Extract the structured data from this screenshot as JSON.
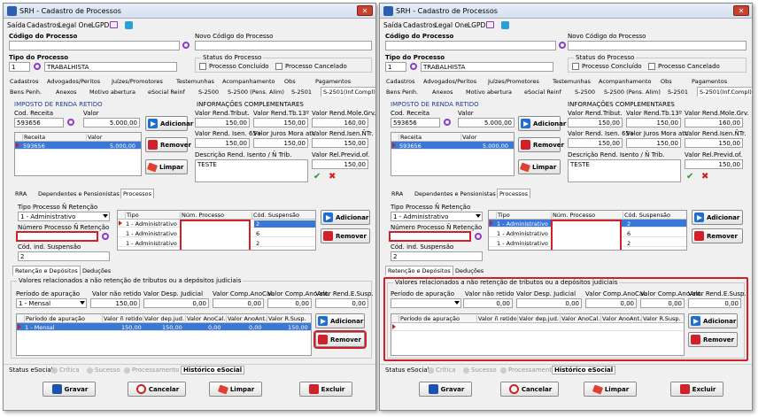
{
  "window": {
    "title": "SRH - Cadastro de Processos"
  },
  "menu": [
    "Saída",
    "Cadastros",
    "Legal One",
    "LGPD"
  ],
  "top": {
    "codigo_label": "Código do Processo",
    "novo_codigo_label": "Novo Código do Processo",
    "tipo_label": "Tipo do Processo",
    "tipo_code": "1",
    "tipo_name": "TRABALHISTA",
    "status_label": "Status do Processo",
    "status_concluido": "Processo Concluído",
    "status_cancelado": "Processo Cancelado"
  },
  "main_tabs_row1": [
    "Cadastros",
    "Advogados/Peritos",
    "Juízes/Promotores",
    "Testemunhas",
    "Acompanhamento",
    "Obs",
    "Pagamentos"
  ],
  "main_tabs_row2": [
    "Bens Penh.",
    "Anexos",
    "Motivo abertura",
    "eSocial Reinf",
    "S-2500",
    "S-2500 (Pens. Alim)",
    "S-2501",
    "S-2501(Inf.Compl)"
  ],
  "ir": {
    "title": "IMPOSTO DE RENDA RETIDO",
    "cod_receita_label": "Cod. Receita",
    "cod_receita": "593656",
    "valor_label": "Valor",
    "valor": "5.000,00",
    "grid_cols": [
      "Receita",
      "Valor"
    ],
    "grid_rows": [
      {
        "receita": "593656",
        "valor": "5.000,00"
      }
    ]
  },
  "info": {
    "title": "INFORMAÇÕES COMPLEMENTARES",
    "labels": [
      "Valor Rend.Tribut.",
      "Valor Rend.Tb.13º",
      "Valor Rend.Mole.Grv.",
      "Valor Rend. Isen. 65+",
      "Valor Juros Mora atr.",
      "Valor Rend.Isen.ÑTr.",
      "Descrição Rend. Isento / Ñ Trib.",
      "Valor Rel.Previd.of."
    ],
    "values": [
      "150,00",
      "150,00",
      "160,00",
      "150,00",
      "150,00",
      "150,00"
    ],
    "descricao": "TESTE",
    "previd": "150,00"
  },
  "buttons": {
    "adicionar": "Adicionar",
    "remover": "Remover",
    "limpar": "Limpar",
    "gravar": "Gravar",
    "cancelar": "Cancelar",
    "limpar_bottom": "Limpar",
    "excluir": "Excluir"
  },
  "sub_tabs": [
    "RRA",
    "Dependentes e Pensionistas",
    "Processos"
  ],
  "proc": {
    "tipo_ret_label": "Tipo Processo Ñ Retenção",
    "tipo_ret_value": "1 - Administrativo",
    "num_proc_label": "Número Processo Ñ Retenção",
    "cod_susp_label": "Cód. ind. Suspensão",
    "cod_susp_value": "2",
    "grid_cols": [
      "Tipo",
      "Núm. Processo",
      "Cód. Suspensão"
    ],
    "grid_rows": [
      {
        "tipo": "1 - Administrativo",
        "cod": "2"
      },
      {
        "tipo": "1 - Administrativo",
        "cod": "6"
      },
      {
        "tipo": "1 - Administrativo",
        "cod": "2"
      }
    ]
  },
  "inner_tabs": [
    "Retenção e Depósitos",
    "Deduções"
  ],
  "ret": {
    "group_title": "Valores relacionados a não retenção de tributos ou a depósitos judiciais",
    "labels": [
      "Período de apuração",
      "Valor não retido",
      "Valor Desp. Judicial",
      "Valor Comp.AnoCal.",
      "Valor Comp.AnoAnt.",
      "Valor Rend.E.Susp."
    ],
    "left_periodo": "1 - Mensal",
    "left_values": [
      "150,00",
      "0,00",
      "0,00",
      "0,00",
      "0,00"
    ],
    "right_values": [
      "0,00",
      "0,00",
      "0,00",
      "0,00",
      "0,00"
    ],
    "grid_cols": [
      "Período de apuração",
      "Valor ñ retido",
      "Valor dep.jud.",
      "Valor AnoCal.",
      "Valor AnoAnt.",
      "Valor R.Susp."
    ],
    "left_row": [
      "1 - Mensal",
      "150,00",
      "150,00",
      "0,00",
      "0,00",
      "150,00"
    ]
  },
  "status_bar": {
    "label": "Status eSocial:",
    "items": [
      "Crítica",
      "Sucesso",
      "Processamento"
    ],
    "historico": "Histórico eSocial"
  }
}
